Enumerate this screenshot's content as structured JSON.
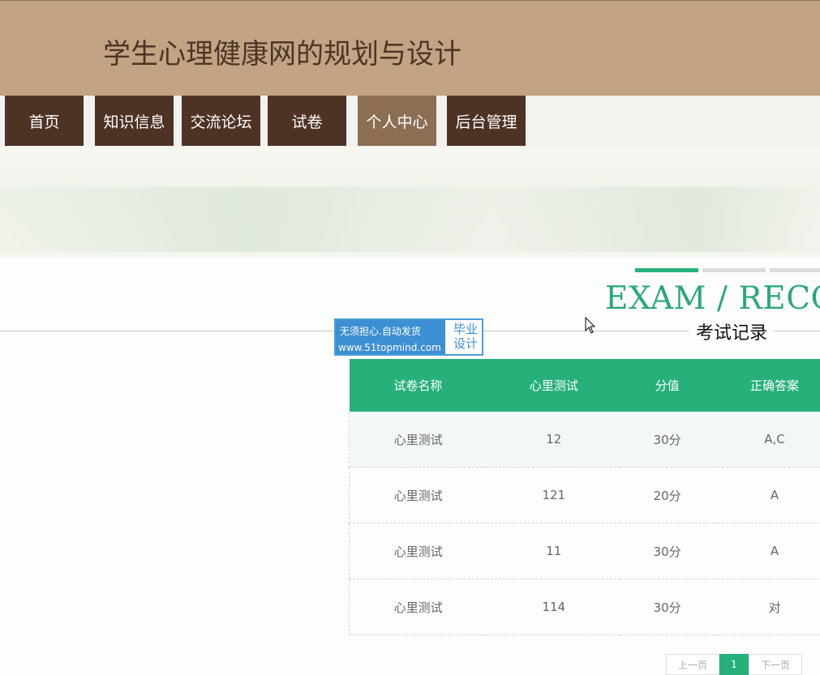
{
  "header": {
    "title": "学生心理健康网的规划与设计"
  },
  "nav": {
    "items": [
      {
        "label": "首页"
      },
      {
        "label": "知识信息"
      },
      {
        "label": "交流论坛"
      },
      {
        "label": "试卷"
      },
      {
        "label": "个人中心"
      },
      {
        "label": "后台管理"
      }
    ],
    "active_label": "个人中心"
  },
  "section": {
    "title_en": "EXAM / RECO",
    "title_cn": "考试记录"
  },
  "badge": {
    "line1": "无须担心.自动发货",
    "line2": "www.51topmind.com",
    "right_line1": "毕业",
    "right_line2": "设计"
  },
  "table": {
    "headers": [
      "试卷名称",
      "心里测试",
      "分值",
      "正确答案"
    ],
    "rows": [
      [
        "心里测试",
        "12",
        "30分",
        "A,C"
      ],
      [
        "心里测试",
        "121",
        "20分",
        "A"
      ],
      [
        "心里测试",
        "11",
        "30分",
        "A"
      ],
      [
        "心里测试",
        "114",
        "30分",
        "对"
      ]
    ]
  },
  "pagination": {
    "prev_label": "上一页",
    "current_page": "1",
    "next_label": "下一页"
  },
  "colors": {
    "header_bg": "#c2a384",
    "nav_bg": "#4e3224",
    "nav_active_bg": "#8b6e54",
    "accent_green": "#26b07a",
    "title_green": "#2aa87a"
  },
  "icons": {
    "cursor": "mouse-pointer-icon"
  }
}
